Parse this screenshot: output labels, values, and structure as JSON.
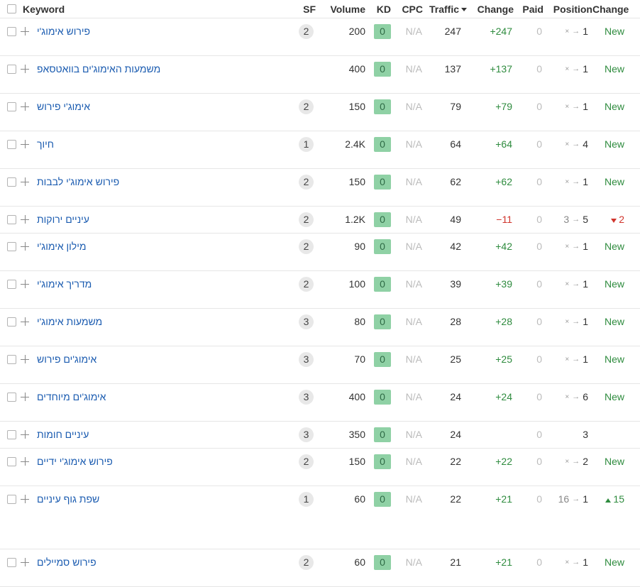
{
  "header": {
    "keyword": "Keyword",
    "sf": "SF",
    "volume": "Volume",
    "kd": "KD",
    "cpc": "CPC",
    "traffic": "Traffic",
    "traffic_change": "Change",
    "paid": "Paid",
    "position": "Position",
    "position_change": "Change"
  },
  "rows": [
    {
      "keyword": "פירוש אימוג'י",
      "sf": "2",
      "volume": "200",
      "kd": "0",
      "cpc": "N/A",
      "traffic": "247",
      "traffic_change": "+247",
      "traffic_change_dir": "up",
      "paid": "0",
      "prev_pos": "×",
      "cur_pos": "1",
      "pos_change": "New",
      "pos_change_dir": "new",
      "row_h": 53
    },
    {
      "keyword": "משמעות האימוג'ים בוואטסאפ",
      "sf": "",
      "volume": "400",
      "kd": "0",
      "cpc": "N/A",
      "traffic": "137",
      "traffic_change": "+137",
      "traffic_change_dir": "up",
      "paid": "0",
      "prev_pos": "×",
      "cur_pos": "1",
      "pos_change": "New",
      "pos_change_dir": "new",
      "row_h": 53
    },
    {
      "keyword": "אימוג'י פירוש",
      "sf": "2",
      "volume": "150",
      "kd": "0",
      "cpc": "N/A",
      "traffic": "79",
      "traffic_change": "+79",
      "traffic_change_dir": "up",
      "paid": "0",
      "prev_pos": "×",
      "cur_pos": "1",
      "pos_change": "New",
      "pos_change_dir": "new",
      "row_h": 53
    },
    {
      "keyword": "חיוך",
      "sf": "1",
      "volume": "2.4K",
      "kd": "0",
      "cpc": "N/A",
      "traffic": "64",
      "traffic_change": "+64",
      "traffic_change_dir": "up",
      "paid": "0",
      "prev_pos": "×",
      "cur_pos": "4",
      "pos_change": "New",
      "pos_change_dir": "new",
      "row_h": 53
    },
    {
      "keyword": "פירוש אימוג'י לבבות",
      "sf": "2",
      "volume": "150",
      "kd": "0",
      "cpc": "N/A",
      "traffic": "62",
      "traffic_change": "+62",
      "traffic_change_dir": "up",
      "paid": "0",
      "prev_pos": "×",
      "cur_pos": "1",
      "pos_change": "New",
      "pos_change_dir": "new",
      "row_h": 53
    },
    {
      "keyword": "עיניים ירוקות",
      "sf": "2",
      "volume": "1.2K",
      "kd": "0",
      "cpc": "N/A",
      "traffic": "49",
      "traffic_change": "−11",
      "traffic_change_dir": "down",
      "paid": "0",
      "prev_pos": "3",
      "cur_pos": "5",
      "pos_change": "2",
      "pos_change_dir": "down",
      "row_h": 38
    },
    {
      "keyword": "מילון אימוג'י",
      "sf": "2",
      "volume": "90",
      "kd": "0",
      "cpc": "N/A",
      "traffic": "42",
      "traffic_change": "+42",
      "traffic_change_dir": "up",
      "paid": "0",
      "prev_pos": "×",
      "cur_pos": "1",
      "pos_change": "New",
      "pos_change_dir": "new",
      "row_h": 53
    },
    {
      "keyword": "מדריך אימוג'י",
      "sf": "2",
      "volume": "100",
      "kd": "0",
      "cpc": "N/A",
      "traffic": "39",
      "traffic_change": "+39",
      "traffic_change_dir": "up",
      "paid": "0",
      "prev_pos": "×",
      "cur_pos": "1",
      "pos_change": "New",
      "pos_change_dir": "new",
      "row_h": 53
    },
    {
      "keyword": "משמעות אימוג'י",
      "sf": "3",
      "volume": "80",
      "kd": "0",
      "cpc": "N/A",
      "traffic": "28",
      "traffic_change": "+28",
      "traffic_change_dir": "up",
      "paid": "0",
      "prev_pos": "×",
      "cur_pos": "1",
      "pos_change": "New",
      "pos_change_dir": "new",
      "row_h": 53
    },
    {
      "keyword": "אימוג'ים פירוש",
      "sf": "3",
      "volume": "70",
      "kd": "0",
      "cpc": "N/A",
      "traffic": "25",
      "traffic_change": "+25",
      "traffic_change_dir": "up",
      "paid": "0",
      "prev_pos": "×",
      "cur_pos": "1",
      "pos_change": "New",
      "pos_change_dir": "new",
      "row_h": 53
    },
    {
      "keyword": "אימוג'ים מיוחדים",
      "sf": "3",
      "volume": "400",
      "kd": "0",
      "cpc": "N/A",
      "traffic": "24",
      "traffic_change": "+24",
      "traffic_change_dir": "up",
      "paid": "0",
      "prev_pos": "×",
      "cur_pos": "6",
      "pos_change": "New",
      "pos_change_dir": "new",
      "row_h": 53
    },
    {
      "keyword": "עיניים חומות",
      "sf": "3",
      "volume": "350",
      "kd": "0",
      "cpc": "N/A",
      "traffic": "24",
      "traffic_change": "",
      "traffic_change_dir": "none",
      "paid": "0",
      "prev_pos": "",
      "cur_pos": "3",
      "pos_change": "",
      "pos_change_dir": "none",
      "row_h": 38
    },
    {
      "keyword": "פירוש אימוג'י ידיים",
      "sf": "2",
      "volume": "150",
      "kd": "0",
      "cpc": "N/A",
      "traffic": "22",
      "traffic_change": "+22",
      "traffic_change_dir": "up",
      "paid": "0",
      "prev_pos": "×",
      "cur_pos": "2",
      "pos_change": "New",
      "pos_change_dir": "new",
      "row_h": 53
    },
    {
      "keyword": "שפת גוף עיניים",
      "sf": "1",
      "volume": "60",
      "kd": "0",
      "cpc": "N/A",
      "traffic": "22",
      "traffic_change": "+21",
      "traffic_change_dir": "up",
      "paid": "0",
      "prev_pos": "16",
      "cur_pos": "1",
      "pos_change": "15",
      "pos_change_dir": "up",
      "row_h": 89
    },
    {
      "keyword": "פירוש סמיילים",
      "sf": "2",
      "volume": "60",
      "kd": "0",
      "cpc": "N/A",
      "traffic": "21",
      "traffic_change": "+21",
      "traffic_change_dir": "up",
      "paid": "0",
      "prev_pos": "×",
      "cur_pos": "1",
      "pos_change": "New",
      "pos_change_dir": "new",
      "row_h": 53
    }
  ]
}
